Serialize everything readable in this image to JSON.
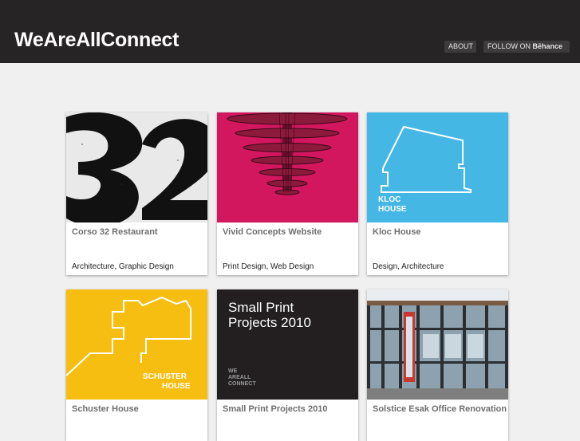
{
  "header": {
    "logo": "WeAreAllConnect",
    "nav": {
      "about": "ABOUT",
      "follow_prefix": "FOLLOW ON",
      "follow_brand": "Bēhance"
    }
  },
  "colors": {
    "header_bg": "#262424",
    "page_bg": "#f0f0f0",
    "pink": "#d2175e",
    "sky_blue": "#45b7e5",
    "yellow": "#f7be12",
    "dark": "#231f20"
  },
  "projects": [
    {
      "title": "Corso 32 Restaurant",
      "tags": "Architecture, Graphic Design",
      "thumb_text": "32"
    },
    {
      "title": "Vivid Concepts Website",
      "tags": "Print Design, Web Design"
    },
    {
      "title": "Kloc House",
      "tags": "Design, Architecture",
      "thumb_text": [
        "KLOC",
        "HOUSE"
      ]
    },
    {
      "title": "Schuster House",
      "tags": "",
      "thumb_text": [
        "SCHUSTER",
        "HOUSE"
      ]
    },
    {
      "title": "Small Print Projects 2010",
      "tags": "",
      "thumb_text": [
        "Small Print",
        "Projects 2010"
      ],
      "thumb_logo": [
        "WE",
        "AREALL",
        "CONNECT"
      ]
    },
    {
      "title": "Solstice Esak Office Renovation",
      "tags": ""
    }
  ]
}
